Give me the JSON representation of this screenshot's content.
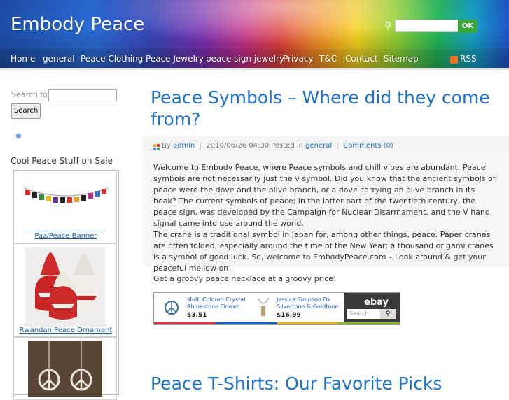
{
  "site": {
    "title": "Embody Peace"
  },
  "header_search": {
    "placeholder": "",
    "button": "OK"
  },
  "nav": {
    "items": [
      "Home",
      "general",
      "Peace Clothing",
      "Peace Jewelry",
      "peace sign jewelry",
      "Privacy",
      "T&C",
      "Contact",
      "Sitemap"
    ],
    "rss": "RSS"
  },
  "sidebar": {
    "search_label": "Search for:",
    "search_button": "Search",
    "heading": "Cool Peace Stuff on Sale",
    "items": [
      "Paz/Peace Banner",
      "Rwandan Peace Ornament"
    ]
  },
  "post": {
    "title": "Peace Symbols – Where did they come from?",
    "meta": {
      "by": "By",
      "author": "admin",
      "date": "2010/06/26 04:30",
      "posted_in": "Posted in",
      "category": "general",
      "comments": "Comments (0)"
    },
    "paragraphs": [
      "Welcome to Embody Peace, where Peace symbols and chill vibes are abundant. Peace symbols are not necessarily just the v symbol. Did you know that the ancient symbols of peace were the dove and the olive branch, or a dove carrying an olive branch in its beak? The current symbols of peace; in the latter part of the twentieth century, the peace sign, was developed by the Campaign for Nuclear Disarmament, and the V hand signal came into use around the world.",
      "The crane is a traditional symbol in Japan for, among other things, peace. Paper cranes are often folded, especially around the time of the New Year; a thousand origami cranes is a symbol of good luck. So, welcome to EmbodyPeace.com – Look around & get your peaceful mellow on!",
      "Get a groovy peace necklace at a groovy price!"
    ]
  },
  "ebay_widget": {
    "logo": "ebay",
    "search_placeholder": "Search",
    "products": [
      {
        "title": "Multi Colored Crystal Rhinestone Flower",
        "price": "$3.51"
      },
      {
        "title": "Jessica Simpson Dk Silvertone & Goldtone",
        "price": "$16.99"
      }
    ]
  },
  "next_post": {
    "title": "Peace T-Shirts: Our Favorite Picks"
  }
}
